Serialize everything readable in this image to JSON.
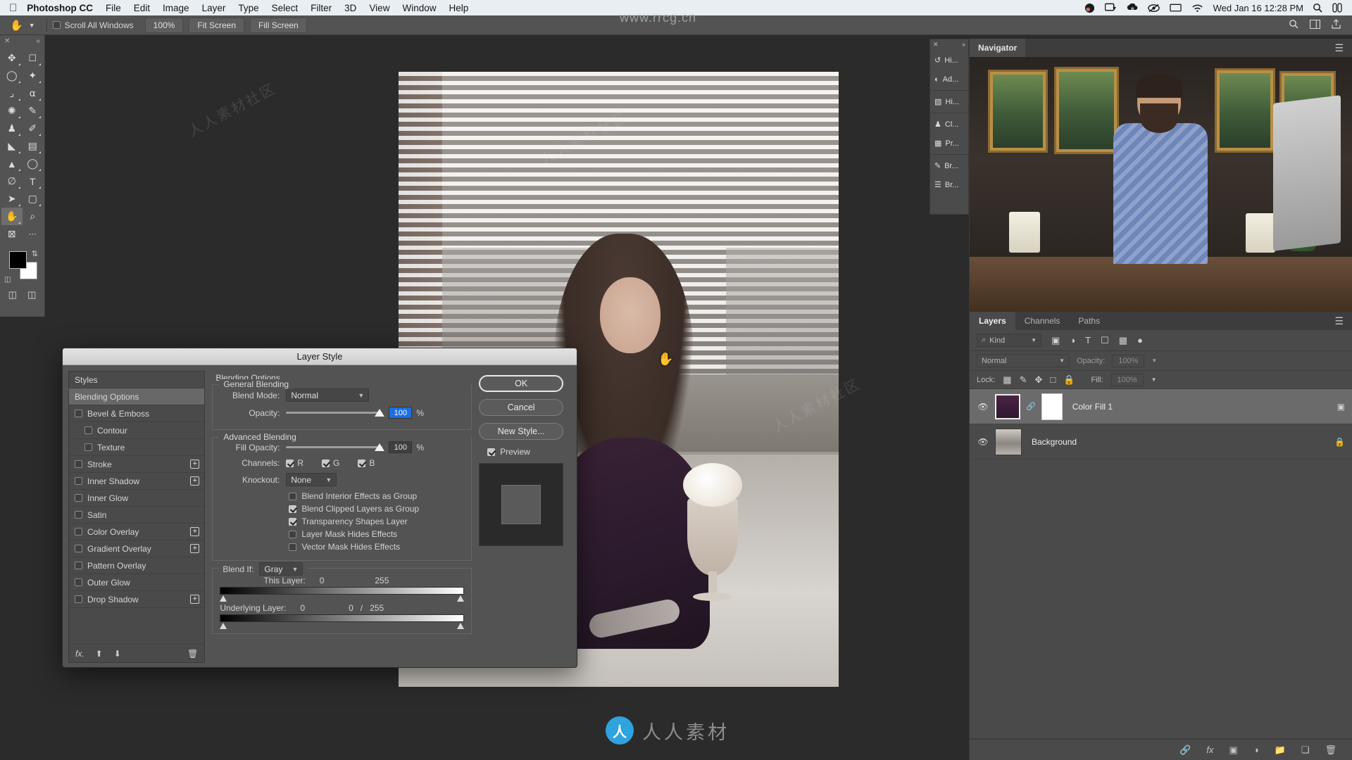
{
  "menubar": {
    "apple_icon": "apple-icon",
    "app_name": "Photoshop CC",
    "items": [
      "File",
      "Edit",
      "Image",
      "Layer",
      "Type",
      "Select",
      "Filter",
      "3D",
      "View",
      "Window",
      "Help"
    ],
    "status_icons": [
      "obs-icon",
      "screen-record-icon",
      "dropbox-icon",
      "eye-icon",
      "display-icon",
      "wifi-icon"
    ],
    "clock": "Wed Jan 16  12:28 PM",
    "search_icon": "search-icon",
    "control_center_icon": "control-center-icon"
  },
  "optionsbar": {
    "tool_icon": "hand-tool-icon",
    "preset_chevron": "chevron-down-icon",
    "scroll_all_windows": {
      "label": "Scroll All Windows",
      "checked": false
    },
    "buttons": [
      "100%",
      "Fit Screen",
      "Fill Screen"
    ],
    "right_icons": [
      "search-icon",
      "workspace-icon",
      "share-icon"
    ]
  },
  "toolbar": {
    "close_icon": "close-icon",
    "collapse_icon": "double-chevron-icon",
    "tools": [
      {
        "name": "move-tool",
        "glyph": "✥"
      },
      {
        "name": "marquee-tool",
        "glyph": "▭"
      },
      {
        "name": "lasso-tool",
        "glyph": "◯"
      },
      {
        "name": "magic-wand-tool",
        "glyph": "✧"
      },
      {
        "name": "crop-tool",
        "glyph": "⌗"
      },
      {
        "name": "eyedropper-tool",
        "glyph": "⌇"
      },
      {
        "name": "spot-healing-tool",
        "glyph": "✺"
      },
      {
        "name": "brush-tool",
        "glyph": "✎"
      },
      {
        "name": "clone-stamp-tool",
        "glyph": "♟"
      },
      {
        "name": "history-brush-tool",
        "glyph": "✐"
      },
      {
        "name": "eraser-tool",
        "glyph": "◣"
      },
      {
        "name": "gradient-tool",
        "glyph": "▤"
      },
      {
        "name": "blur-tool",
        "glyph": "▲"
      },
      {
        "name": "dodge-tool",
        "glyph": "✇"
      },
      {
        "name": "pen-tool",
        "glyph": "✒"
      },
      {
        "name": "type-tool",
        "glyph": "T"
      },
      {
        "name": "path-selection-tool",
        "glyph": "➤"
      },
      {
        "name": "rectangle-tool",
        "glyph": "▢"
      },
      {
        "name": "hand-tool",
        "glyph": "✋",
        "active": true
      },
      {
        "name": "zoom-tool",
        "glyph": "⌕"
      },
      {
        "name": "edit-toolbar-tool",
        "glyph": "⊠"
      },
      {
        "name": "more-tools",
        "glyph": "•••"
      }
    ],
    "foreground_color": "#000000",
    "background_color": "#ffffff",
    "swap_icon": "swap-colors-icon",
    "default_colors_icon": "default-colors-icon",
    "quick_mask_icon": "quick-mask-icon",
    "screen_mode_icon": "screen-mode-icon"
  },
  "dialog": {
    "title": "Layer Style",
    "styles_list": [
      {
        "label": "Styles",
        "type": "plain"
      },
      {
        "label": "Blending Options",
        "type": "selected"
      },
      {
        "label": "Bevel & Emboss",
        "type": "check",
        "checked": false,
        "plus": false
      },
      {
        "label": "Contour",
        "type": "check",
        "checked": false,
        "indent": true
      },
      {
        "label": "Texture",
        "type": "check",
        "checked": false,
        "indent": true
      },
      {
        "label": "Stroke",
        "type": "check",
        "checked": false,
        "plus": true
      },
      {
        "label": "Inner Shadow",
        "type": "check",
        "checked": false,
        "plus": true
      },
      {
        "label": "Inner Glow",
        "type": "check",
        "checked": false
      },
      {
        "label": "Satin",
        "type": "check",
        "checked": false
      },
      {
        "label": "Color Overlay",
        "type": "check",
        "checked": false,
        "plus": true
      },
      {
        "label": "Gradient Overlay",
        "type": "check",
        "checked": false,
        "plus": true
      },
      {
        "label": "Pattern Overlay",
        "type": "check",
        "checked": false
      },
      {
        "label": "Outer Glow",
        "type": "check",
        "checked": false
      },
      {
        "label": "Drop Shadow",
        "type": "check",
        "checked": false,
        "plus": true
      }
    ],
    "list_footer": {
      "fx_icon": "fx-icon",
      "up_icon": "move-up-icon",
      "down_icon": "move-down-icon",
      "trash_icon": "trash-icon"
    },
    "panel_title": "Blending Options",
    "general_blending": {
      "legend": "General Blending",
      "blend_mode_label": "Blend Mode:",
      "blend_mode_value": "Normal",
      "opacity_label": "Opacity:",
      "opacity_value": "100",
      "opacity_unit": "%"
    },
    "advanced_blending": {
      "legend": "Advanced Blending",
      "fill_opacity_label": "Fill Opacity:",
      "fill_opacity_value": "100",
      "fill_opacity_unit": "%",
      "channels_label": "Channels:",
      "channels": [
        {
          "label": "R",
          "checked": true
        },
        {
          "label": "G",
          "checked": true
        },
        {
          "label": "B",
          "checked": true
        }
      ],
      "knockout_label": "Knockout:",
      "knockout_value": "None",
      "checkboxes": [
        {
          "label": "Blend Interior Effects as Group",
          "checked": false
        },
        {
          "label": "Blend Clipped Layers as Group",
          "checked": true
        },
        {
          "label": "Transparency Shapes Layer",
          "checked": true
        },
        {
          "label": "Layer Mask Hides Effects",
          "checked": false
        },
        {
          "label": "Vector Mask Hides Effects",
          "checked": false
        }
      ]
    },
    "blend_if": {
      "label": "Blend If:",
      "value": "Gray",
      "this_layer_label": "This Layer:",
      "this_layer_min": "0",
      "this_layer_max": "255",
      "underlying_label": "Underlying Layer:",
      "underlying_min": "0",
      "underlying_mid": "0",
      "underlying_sep": "/",
      "underlying_max": "255"
    },
    "buttons": {
      "ok": "OK",
      "cancel": "Cancel",
      "new_style": "New Style...",
      "preview_label": "Preview",
      "preview_checked": true
    }
  },
  "minidock": {
    "close_icon": "close-icon",
    "expand_icon": "double-chevron-icon",
    "groups": [
      [
        {
          "name": "history-panel",
          "label": "Hi...",
          "icon": "history-icon"
        },
        {
          "name": "adjustments-panel",
          "label": "Ad...",
          "icon": "adjustments-icon"
        }
      ],
      [
        {
          "name": "histogram-panel",
          "label": "Hi...",
          "icon": "histogram-icon"
        }
      ],
      [
        {
          "name": "clone-source-panel",
          "label": "Cl...",
          "icon": "clone-source-icon"
        },
        {
          "name": "properties-panel",
          "label": "Pr...",
          "icon": "properties-icon"
        }
      ],
      [
        {
          "name": "brush-presets-panel",
          "label": "Br...",
          "icon": "brush-icon"
        },
        {
          "name": "brush-settings-panel",
          "label": "Br...",
          "icon": "brush-settings-icon"
        }
      ]
    ]
  },
  "navigator": {
    "tab": "Navigator",
    "menu_icon": "panel-menu-icon"
  },
  "layers_panel": {
    "tabs": [
      {
        "label": "Layers",
        "active": true
      },
      {
        "label": "Channels",
        "active": false
      },
      {
        "label": "Paths",
        "active": false
      }
    ],
    "menu_icon": "panel-menu-icon",
    "filter": {
      "kind_label": "Kind",
      "search_icon": "search-icon",
      "chevron_icon": "chevron-down-icon",
      "filter_icons": [
        "pixel-filter-icon",
        "adjustment-filter-icon",
        "type-filter-icon",
        "shape-filter-icon",
        "smart-object-filter-icon"
      ],
      "toggle_icon": "filter-toggle-icon"
    },
    "blend_row": {
      "mode": "Normal",
      "opacity_label": "Opacity:",
      "opacity_value": "100%"
    },
    "lock_row": {
      "label": "Lock:",
      "icons": [
        "lock-transparency-icon",
        "lock-image-icon",
        "lock-position-icon",
        "lock-artboard-icon",
        "lock-all-icon"
      ],
      "fill_label": "Fill:",
      "fill_value": "100%"
    },
    "layers": [
      {
        "name": "Color Fill 1",
        "selected": true,
        "visible": true,
        "eye_icon": "eye-icon",
        "link_icon": "link-mask-icon",
        "right_icon": "smart-filter-icon"
      },
      {
        "name": "Background",
        "selected": false,
        "visible": true,
        "eye_icon": "eye-icon",
        "right_icon": "lock-icon"
      }
    ],
    "bottom_icons": [
      "link-layers-icon",
      "fx-icon",
      "add-mask-icon",
      "adjustment-layer-icon",
      "new-group-icon",
      "new-layer-icon",
      "delete-layer-icon"
    ]
  },
  "watermarks": {
    "url": "www.rrcg.cn",
    "brand": "人人素材",
    "logo_text": "人",
    "tile_text": "人人素材社区"
  }
}
